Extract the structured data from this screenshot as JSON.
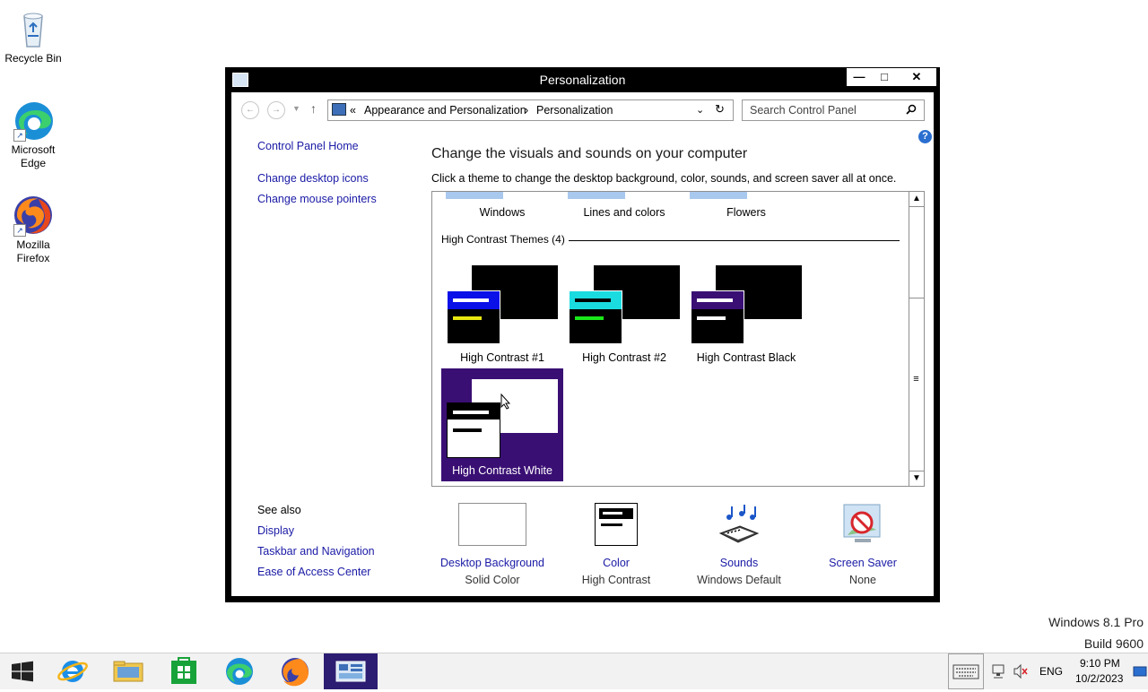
{
  "desktop": {
    "icons": [
      {
        "label": "Recycle Bin"
      },
      {
        "label": "Microsoft Edge"
      },
      {
        "label": "Mozilla Firefox"
      }
    ],
    "watermark": {
      "line1": "Windows 8.1 Pro",
      "line2": "Build 9600"
    }
  },
  "window": {
    "title": "Personalization",
    "controls": {
      "minimize": "—",
      "maximize": "□",
      "close": "✕"
    },
    "address": {
      "chevron": "«",
      "crumb1": "Appearance and Personalization",
      "sep": "›",
      "crumb2": "Personalization"
    },
    "search": {
      "placeholder": "Search Control Panel"
    },
    "left_pane": {
      "links": [
        "Control Panel Home",
        "Change desktop icons",
        "Change mouse pointers"
      ],
      "see_also_label": "See also",
      "see_also": [
        "Display",
        "Taskbar and Navigation",
        "Ease of Access Center"
      ]
    },
    "main": {
      "heading": "Change the visuals and sounds on your computer",
      "subheading": "Click a theme to change the desktop background, color, sounds, and screen saver all at once.",
      "top_themes": [
        "Windows",
        "Lines and colors",
        "Flowers"
      ],
      "group_label": "High Contrast Themes (4)",
      "hc_themes": [
        {
          "name": "High Contrast #1",
          "title_color": "#0a10e8",
          "bar1": "#ffffff",
          "bar2": "#e8e810"
        },
        {
          "name": "High Contrast #2",
          "title_color": "#1adce0",
          "bar1": "#000000",
          "bar2": "#1ae81a"
        },
        {
          "name": "High Contrast Black",
          "title_color": "#3a0f74",
          "bar1": "#ffffff",
          "bar2": "#ffffff"
        },
        {
          "name": "High Contrast White",
          "title_color": "#000000",
          "bar1": "#ffffff",
          "bar2": "#000000"
        }
      ],
      "selected_theme": "High Contrast White"
    },
    "settings": [
      {
        "name": "Desktop Background",
        "value": "Solid Color"
      },
      {
        "name": "Color",
        "value": "High Contrast"
      },
      {
        "name": "Sounds",
        "value": "Windows Default"
      },
      {
        "name": "Screen Saver",
        "value": "None"
      }
    ]
  },
  "taskbar": {
    "tray": {
      "lang": "ENG",
      "time": "9:10 PM",
      "date": "10/2/2023"
    }
  }
}
